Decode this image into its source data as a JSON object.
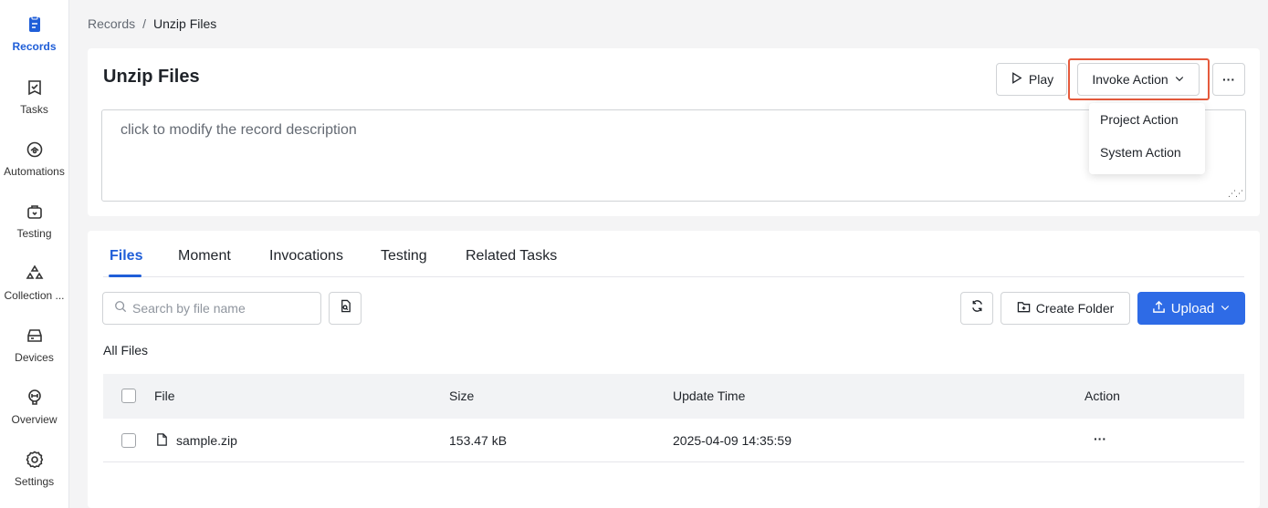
{
  "sidebar": {
    "items": [
      {
        "label": "Records",
        "icon": "records-icon",
        "active": true
      },
      {
        "label": "Tasks",
        "icon": "tasks-icon"
      },
      {
        "label": "Automations",
        "icon": "automations-icon"
      },
      {
        "label": "Testing",
        "icon": "testing-icon"
      },
      {
        "label": "Collection ...",
        "icon": "collection-icon"
      },
      {
        "label": "Devices",
        "icon": "devices-icon"
      },
      {
        "label": "Overview",
        "icon": "overview-icon"
      },
      {
        "label": "Settings",
        "icon": "gear-icon"
      }
    ]
  },
  "breadcrumb": {
    "parent": "Records",
    "separator": "/",
    "current": "Unzip Files"
  },
  "header": {
    "title": "Unzip Files",
    "description_placeholder": "click to modify the record description",
    "play_label": "Play",
    "invoke_label": "Invoke Action",
    "more_label": "···",
    "dropdown": [
      "Project Action",
      "System Action"
    ]
  },
  "tabs": [
    "Files",
    "Moment",
    "Invocations",
    "Testing",
    "Related Tasks"
  ],
  "toolbar": {
    "search_placeholder": "Search by file name",
    "create_folder_label": "Create Folder",
    "upload_label": "Upload"
  },
  "all_files_label": "All Files",
  "table": {
    "columns": [
      "File",
      "Size",
      "Update Time",
      "Action"
    ],
    "rows": [
      {
        "file": "sample.zip",
        "size": "153.47 kB",
        "updated": "2025-04-09 14:35:59",
        "action": "···"
      }
    ]
  },
  "colors": {
    "accent": "#2e6be6",
    "highlight": "#e55a3c"
  }
}
